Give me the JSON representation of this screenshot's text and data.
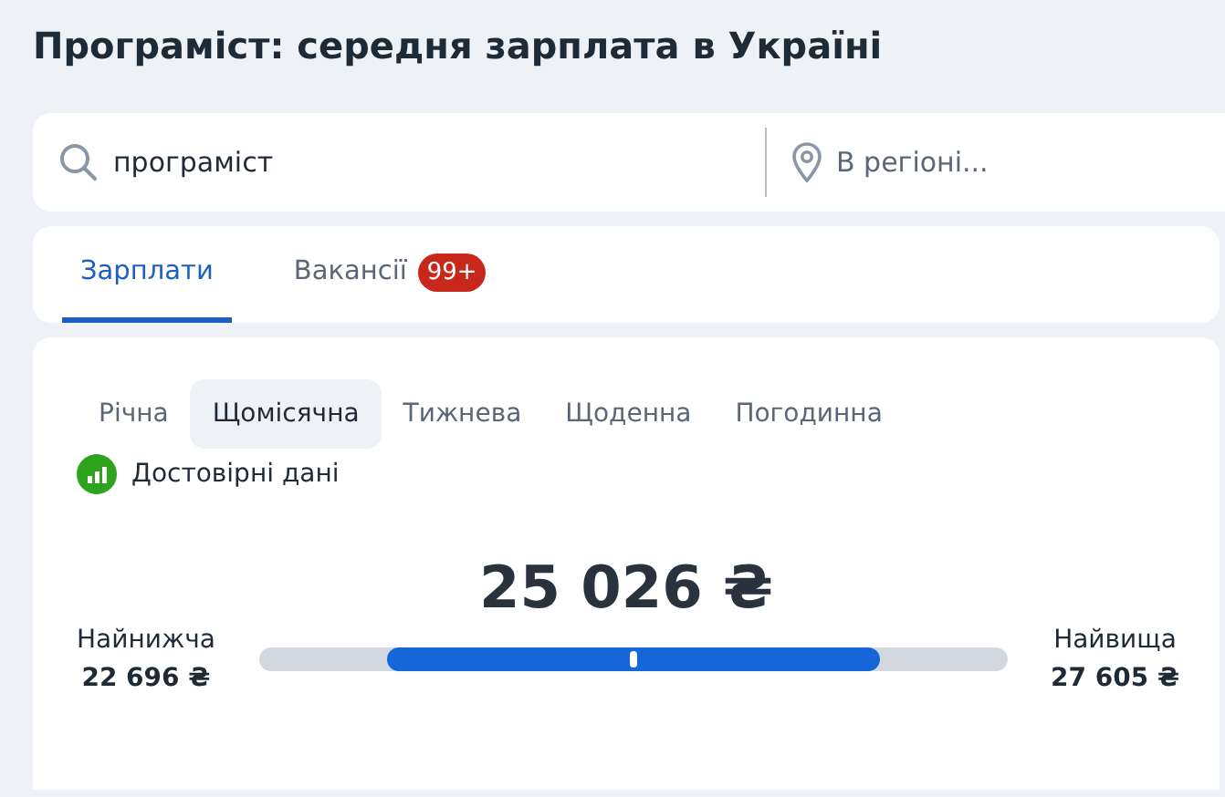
{
  "title": "Програміст: середня зарплата в Україні",
  "search": {
    "value": "програміст",
    "region_placeholder": "В регіоні..."
  },
  "tabs": [
    {
      "label": "Зарплати",
      "selected": true
    },
    {
      "label": "Вакансії",
      "selected": false,
      "badge": "99+"
    }
  ],
  "periods": [
    {
      "label": "Річна",
      "selected": false
    },
    {
      "label": "Щомісячна",
      "selected": true
    },
    {
      "label": "Тижнева",
      "selected": false
    },
    {
      "label": "Щоденна",
      "selected": false
    },
    {
      "label": "Погодинна",
      "selected": false
    }
  ],
  "reliability": {
    "label": "Достовірні дані",
    "color": "#2ea31d"
  },
  "salary": {
    "average": "25 026 ₴",
    "min_label": "Найнижча",
    "min_value": "22 696 ₴",
    "max_label": "Найвища",
    "max_value": "27 605 ₴"
  }
}
